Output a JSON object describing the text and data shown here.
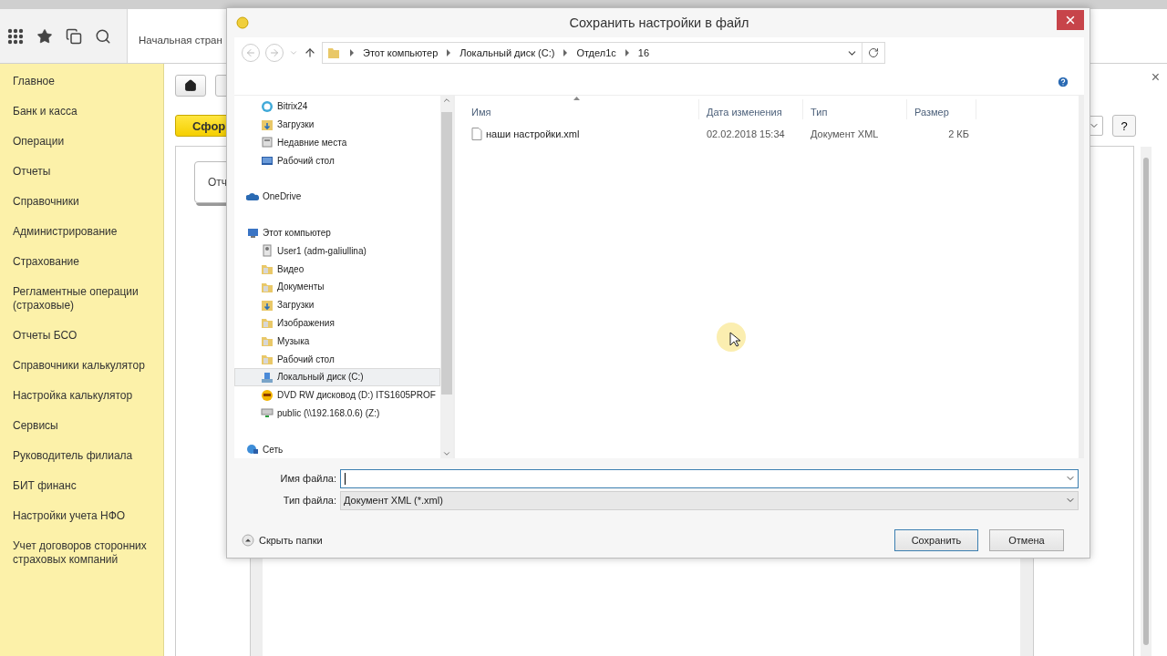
{
  "app": {
    "tab_label": "Начальная стран",
    "sidebar": [
      "Главное",
      "Банк и касса",
      "Операции",
      "Отчеты",
      "Справочники",
      "Администрирование",
      "Страхование",
      "Регламентные операции (страховые)",
      "Отчеты БСО",
      "Справочники калькулятор",
      "Настройка калькулятор",
      "Сервисы",
      "Руководитель филиала",
      "БИТ финанс",
      "Настройки учета НФО",
      "Учет договоров сторонних страховых компаний"
    ],
    "generate_button": "Сфор",
    "card_label": "Отч",
    "help_button": "?",
    "close_mark": "×"
  },
  "dialog": {
    "title": "Сохранить настройки в файл",
    "breadcrumbs": [
      "Этот компьютер",
      "Локальный диск (C:)",
      "Отдел1с",
      "16"
    ],
    "nav_orphans": [
      {
        "label": "Bitrix24",
        "kind": "app",
        "selected": false
      },
      {
        "label": "Загрузки",
        "kind": "downloads",
        "selected": false
      },
      {
        "label": "Недавние места",
        "kind": "recent",
        "selected": false
      },
      {
        "label": "Рабочий стол",
        "kind": "desktop",
        "selected": false
      }
    ],
    "nav_tree": [
      {
        "label": "OneDrive",
        "kind": "cloud",
        "selected": false
      },
      {
        "label": "Этот компьютер",
        "kind": "computer",
        "selected": false,
        "children": [
          {
            "label": "User1 (adm-galiullina)",
            "kind": "user",
            "selected": false
          },
          {
            "label": "Видео",
            "kind": "folder",
            "selected": false
          },
          {
            "label": "Документы",
            "kind": "folder",
            "selected": false
          },
          {
            "label": "Загрузки",
            "kind": "downloads",
            "selected": false
          },
          {
            "label": "Изображения",
            "kind": "folder",
            "selected": false
          },
          {
            "label": "Музыка",
            "kind": "folder",
            "selected": false
          },
          {
            "label": "Рабочий стол",
            "kind": "folder",
            "selected": false
          },
          {
            "label": "Локальный диск (C:)",
            "kind": "disk",
            "selected": true
          },
          {
            "label": "DVD RW дисковод (D:) ITS1605PROF",
            "kind": "dvd",
            "selected": false
          },
          {
            "label": "public (\\\\192.168.0.6) (Z:)",
            "kind": "netdrive",
            "selected": false
          }
        ]
      },
      {
        "label": "Сеть",
        "kind": "network",
        "selected": false
      }
    ],
    "columns": [
      "Имя",
      "Дата изменения",
      "Тип",
      "Размер"
    ],
    "files": [
      {
        "name": "наши настройки.xml",
        "date": "02.02.2018 15:34",
        "type": "Документ XML",
        "size": "2 КБ"
      }
    ],
    "file_name_label": "Имя файла:",
    "file_type_label": "Тип файла:",
    "file_type": "Документ XML (*.xml)",
    "hide_folders": "Скрыть папки",
    "buttons": [
      {
        "label": "Сохранить",
        "default": true
      },
      {
        "label": "Отмена",
        "default": false
      }
    ]
  }
}
